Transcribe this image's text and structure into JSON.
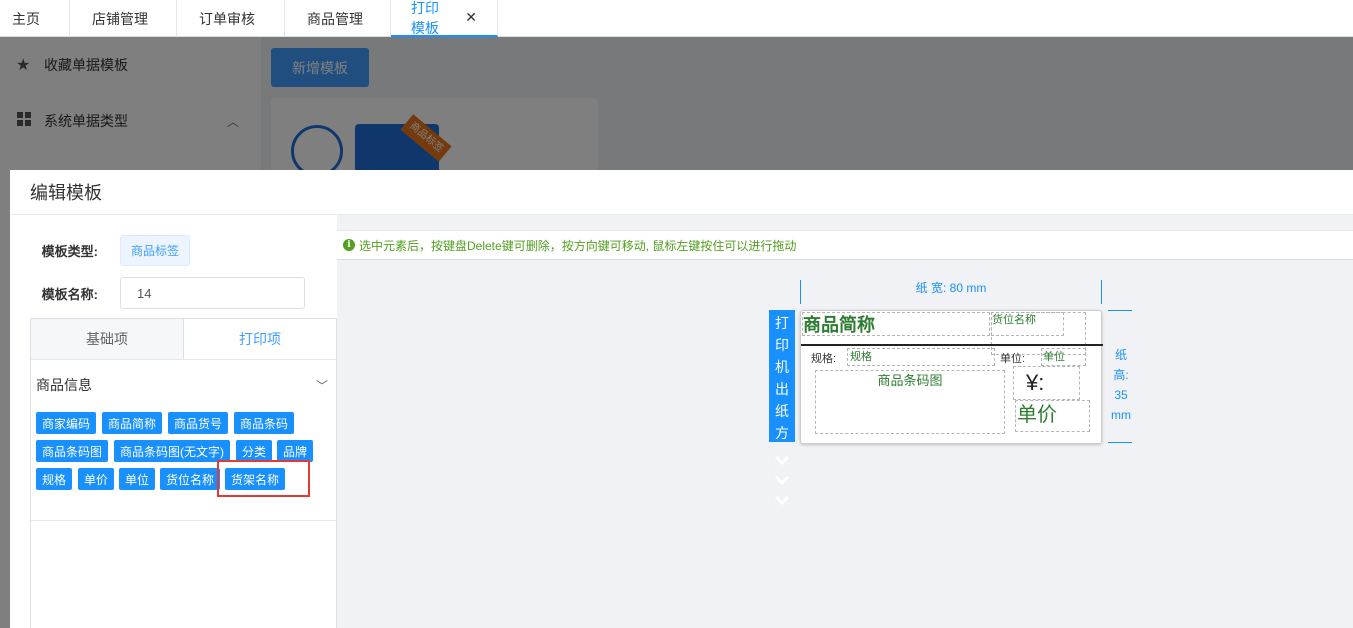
{
  "top_tabs": [
    {
      "label": "主页"
    },
    {
      "label": "店铺管理"
    },
    {
      "label": "订单审核"
    },
    {
      "label": "商品管理"
    },
    {
      "label": "打印模板",
      "close": "✕"
    }
  ],
  "bg_sidebar": {
    "items": [
      {
        "label": "收藏单据模板",
        "icon": "star-icon"
      },
      {
        "label": "系统单据类型",
        "icon": "grid-icon"
      }
    ]
  },
  "bg_main": {
    "add_button": "新增模板",
    "card_ribbon": "商品标签"
  },
  "dialog": {
    "title": "编辑模板",
    "type_label": "模板类型:",
    "type_value": "商品标签",
    "name_label": "模板名称:",
    "name_value": "14",
    "tabs": [
      "基础项",
      "打印项"
    ],
    "section_title": "商品信息",
    "fields": [
      "商家编码",
      "商品简称",
      "商品货号",
      "商品条码",
      "商品条码图",
      "商品条码图(无文字)",
      "分类",
      "品牌",
      "规格",
      "单价",
      "单位",
      "货位名称",
      "货架名称"
    ]
  },
  "canvas": {
    "hint": "选中元素后，按键盘Delete键可删除，按方向键可移动, 鼠标左键按住可以进行拖动",
    "paper_width": "纸 宽: 80 mm",
    "paper_height": [
      "纸",
      "高:",
      "35",
      "mm"
    ],
    "direction": "打印机出纸方向",
    "elements": {
      "name": "商品简称",
      "location": "货位名称",
      "spec_label": "规格:",
      "spec": "规格",
      "unit_label": "单位:",
      "unit": "单位",
      "barcode": "商品条码图",
      "yen": "¥:",
      "price": "单价"
    }
  },
  "colors": {
    "accent": "#1890ff",
    "hint_green": "#52a01e",
    "element_green": "#2e7d32",
    "highlight_red": "#e53935"
  }
}
